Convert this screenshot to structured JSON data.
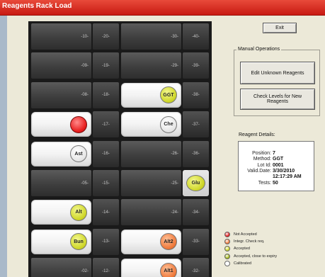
{
  "window": {
    "title": "Reagents Rack Load"
  },
  "rack": {
    "rows": [
      {
        "pos": [
          "-10-",
          "-20-",
          "-30-",
          "-40-"
        ],
        "reagents": [
          null,
          null,
          null,
          null
        ]
      },
      {
        "pos": [
          "-09-",
          "-19-",
          "-29-",
          "-39-"
        ],
        "reagents": [
          null,
          null,
          null,
          null
        ]
      },
      {
        "pos": [
          "-08-",
          "-18-",
          "",
          "-38-"
        ],
        "reagents": [
          null,
          null,
          {
            "label": "GGT",
            "color": "yellow"
          },
          null
        ]
      },
      {
        "pos": [
          "",
          "-17-",
          "",
          "-37-"
        ],
        "reagents": [
          {
            "label": "",
            "color": "red"
          },
          null,
          {
            "label": "Che",
            "color": "white"
          },
          null
        ]
      },
      {
        "pos": [
          "",
          "-16-",
          "-26-",
          "-36-"
        ],
        "reagents": [
          {
            "label": "Ast",
            "color": "white"
          },
          null,
          null,
          null
        ]
      },
      {
        "pos": [
          "-05-",
          "-15-",
          "-25-",
          ""
        ],
        "reagents": [
          null,
          null,
          null,
          {
            "label": "Glu",
            "color": "yellow"
          }
        ]
      },
      {
        "pos": [
          "",
          "-14-",
          "-24-",
          "-34-"
        ],
        "reagents": [
          {
            "label": "Alt",
            "color": "yellow"
          },
          null,
          null,
          null
        ]
      },
      {
        "pos": [
          "",
          "-13-",
          "",
          "-33-"
        ],
        "reagents": [
          {
            "label": "Bun",
            "color": "yellow"
          },
          null,
          {
            "label": "Alt2",
            "color": "orange"
          },
          null
        ]
      },
      {
        "pos": [
          "-02-",
          "-12-",
          "",
          "-32-"
        ],
        "reagents": [
          null,
          null,
          {
            "label": "Alt1",
            "color": "orange"
          },
          null
        ]
      }
    ]
  },
  "buttons": {
    "exit": "Exit",
    "edit_unknown": "Edit Unknown Reagents",
    "check_levels": "Check Levels for New Reagents"
  },
  "manual_ops": {
    "title": "Manual Operations"
  },
  "details": {
    "title": "Reagent Details:",
    "fields": [
      {
        "key": "Position:",
        "value": "7"
      },
      {
        "key": "Method:",
        "value": "GGT"
      },
      {
        "key": "Lot Id:",
        "value": "0001"
      },
      {
        "key": "Valid.Date:",
        "value": "3/30/2010"
      },
      {
        "key": "",
        "value": "12:17:29 AM"
      },
      {
        "key": "Tests:",
        "value": "50"
      }
    ]
  },
  "legend": [
    {
      "label": "Not Accepted",
      "color": "#e81e1e"
    },
    {
      "label": "Integr. Check req.",
      "color": "#ef7a3c"
    },
    {
      "label": "Accepted",
      "color": "#cfd72a"
    },
    {
      "label": "Accepted, close to expiry",
      "color": "#a6b81a"
    },
    {
      "label": "Calibrated",
      "color": "#ffffff"
    }
  ]
}
